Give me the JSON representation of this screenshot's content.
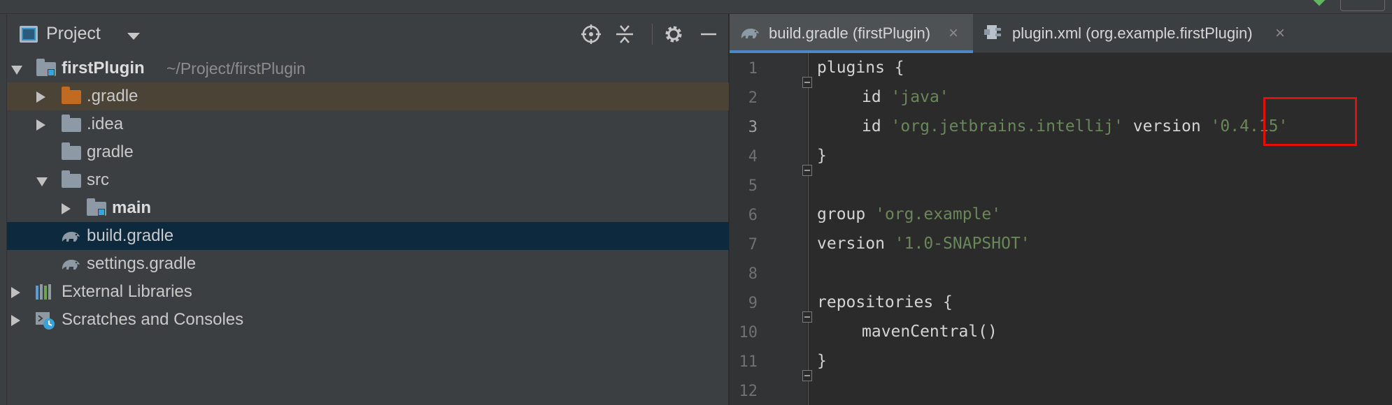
{
  "project_pane": {
    "title": "Project",
    "tree": [
      {
        "label": "firstPlugin",
        "sub": "~/Project/firstPlugin"
      },
      {
        "label": ".gradle"
      },
      {
        "label": ".idea"
      },
      {
        "label": "gradle"
      },
      {
        "label": "src"
      },
      {
        "label": "main"
      },
      {
        "label": "build.gradle"
      },
      {
        "label": "settings.gradle"
      },
      {
        "label": "External Libraries"
      },
      {
        "label": "Scratches and Consoles"
      }
    ]
  },
  "tabs": [
    {
      "label": "build.gradle (firstPlugin)",
      "close": "×",
      "icon": "gradle-elephant-icon"
    },
    {
      "label": "plugin.xml (org.example.firstPlugin)",
      "close": "×",
      "icon": "plugin-xml-icon"
    }
  ],
  "editor": {
    "line_numbers": [
      "1",
      "2",
      "3",
      "4",
      "5",
      "6",
      "7",
      "8",
      "9",
      "10",
      "11",
      "12"
    ],
    "lines": [
      {
        "a": "plugins",
        "b": " {"
      },
      {
        "a": "id",
        "b": "'java'"
      },
      {
        "a": "id",
        "b": "'org.jetbrains.intellij'",
        "c": "version",
        "d": "'0.4.15'"
      },
      {
        "a": "}"
      },
      {},
      {
        "a": "group",
        "b": "'org.example'"
      },
      {
        "a": "version",
        "b": "'1.0-SNAPSHOT'"
      },
      {},
      {
        "a": "repositories",
        "b": " {"
      },
      {
        "a": "mavenCentral()"
      },
      {
        "a": "}"
      },
      {}
    ]
  },
  "colors": {
    "keyword": "#cc9d74",
    "string": "#6a8759",
    "selection": "#0d293e",
    "highlight_box": "#e01010"
  }
}
